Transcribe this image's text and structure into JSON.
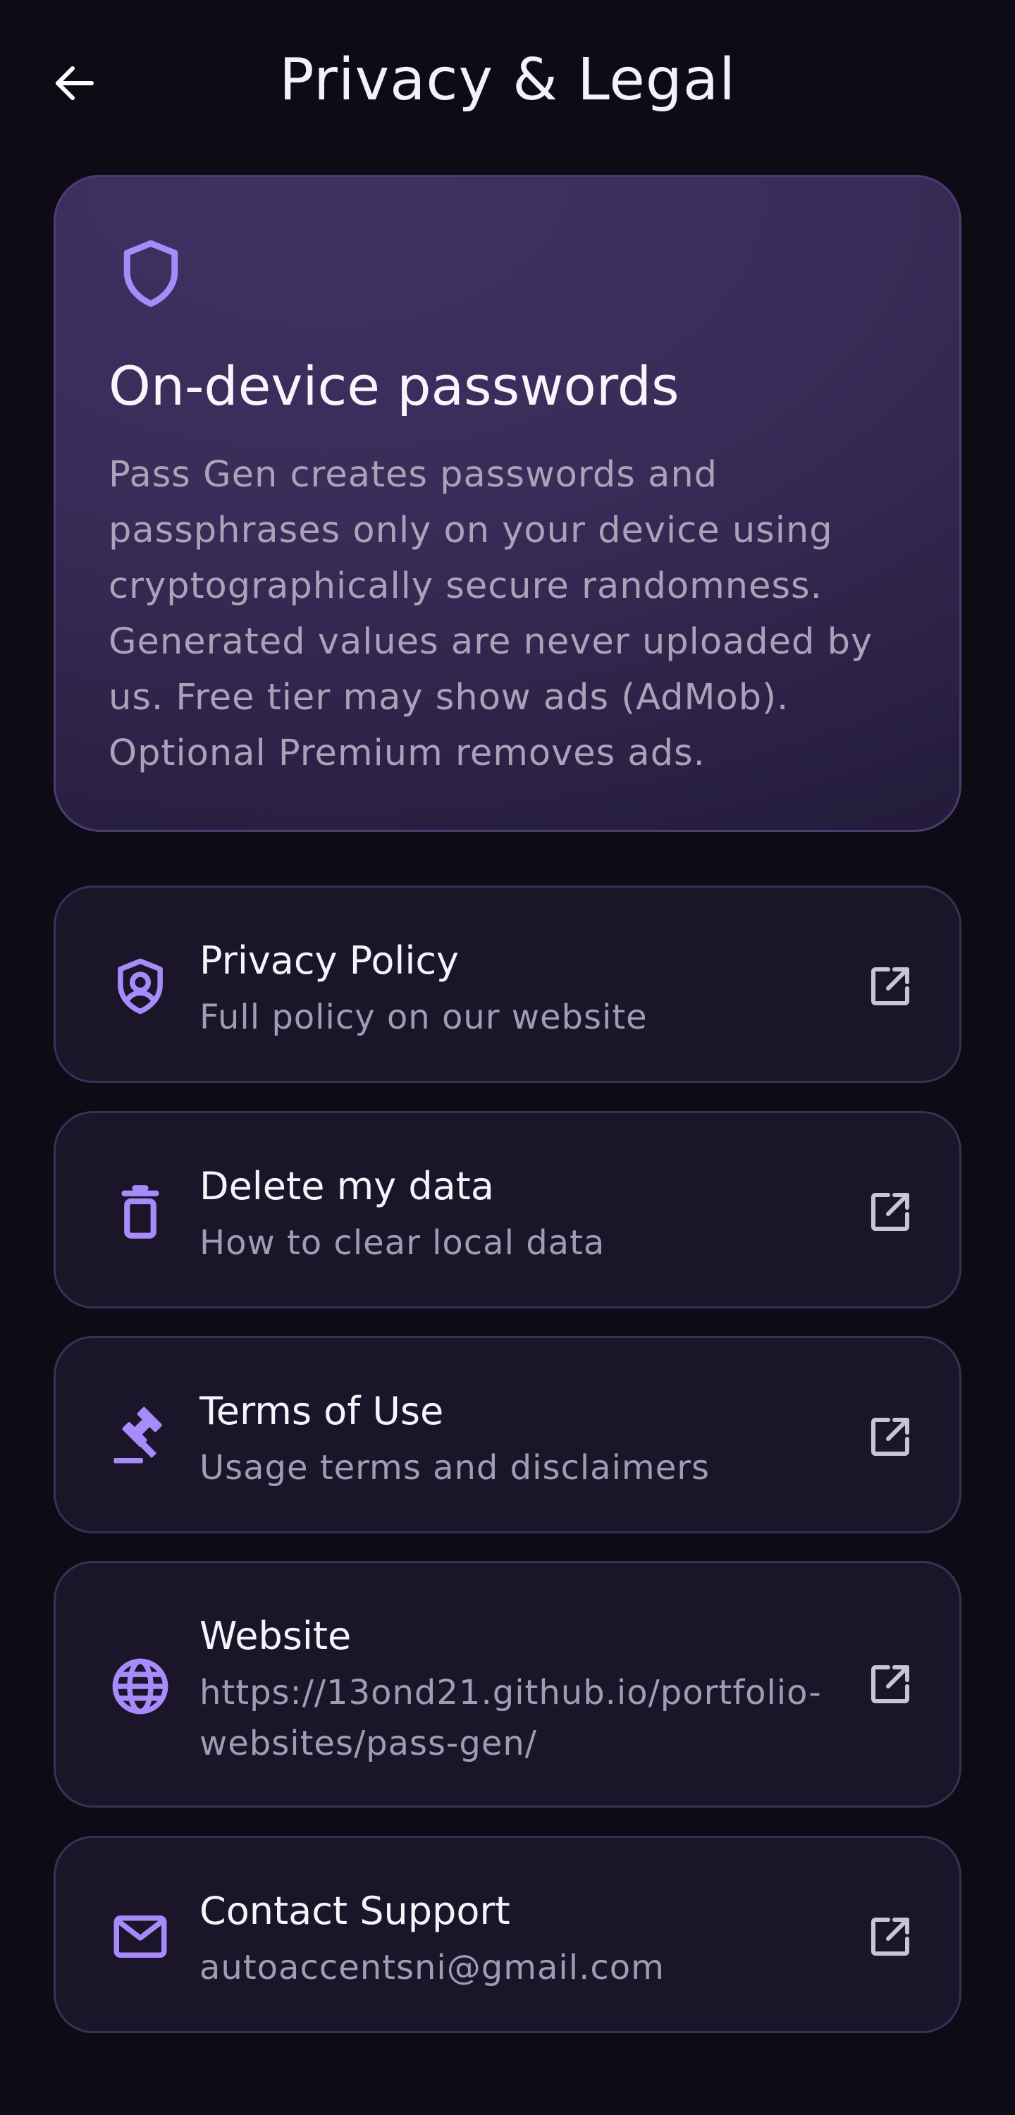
{
  "header": {
    "back_label": "Back",
    "title": "Privacy & Legal"
  },
  "hero": {
    "icon": "shield-icon",
    "title": "On-device passwords",
    "description": "Pass Gen creates passwords and passphrases only on your device using cryptographically secure randomness. Generated values are never uploaded by us. Free tier may show ads (AdMob). Optional Premium removes ads."
  },
  "items": [
    {
      "icon": "shield-account-icon",
      "title": "Privacy Policy",
      "subtitle": "Full policy on our website",
      "action_icon": "open-external-icon"
    },
    {
      "icon": "trash-icon",
      "title": "Delete my data",
      "subtitle": "How to clear local data",
      "action_icon": "open-external-icon"
    },
    {
      "icon": "gavel-icon",
      "title": "Terms of Use",
      "subtitle": "Usage terms and disclaimers",
      "action_icon": "open-external-icon"
    },
    {
      "icon": "globe-icon",
      "title": "Website",
      "subtitle": "https://13ond21.github.io/portfolio-websites/pass-gen/",
      "action_icon": "open-external-icon"
    },
    {
      "icon": "mail-icon",
      "title": "Contact Support",
      "subtitle": "autoaccentsni@gmail.com",
      "action_icon": "open-external-icon"
    }
  ],
  "colors": {
    "background": "#0e0b17",
    "accent": "#a78bfa",
    "card": "#1b1529",
    "card_border": "#3a3056",
    "hero_gradient_start": "#3f3263",
    "hero_gradient_end": "#211a36",
    "text_secondary": "#a29cb2"
  }
}
